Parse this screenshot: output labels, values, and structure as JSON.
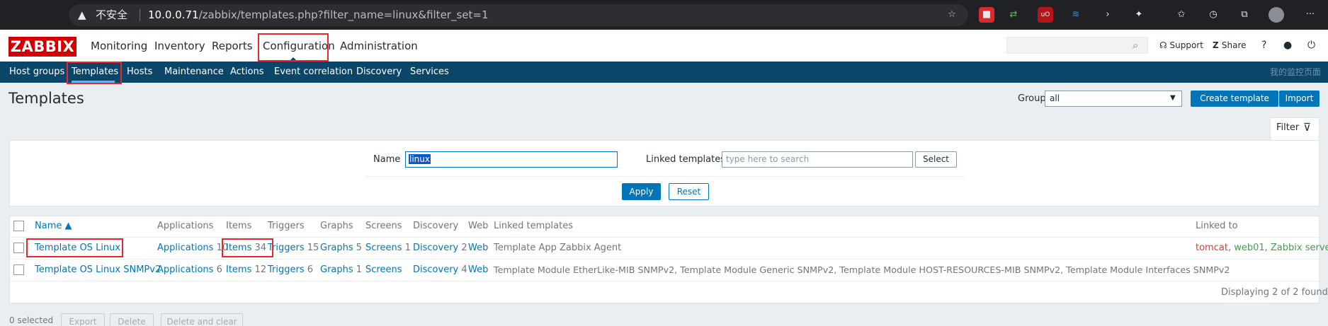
{
  "browser": {
    "url_warning": "不安全",
    "url_host": "10.0.0.71",
    "url_path": "/zabbix/templates.php?filter_name=linux&filter_set=1"
  },
  "header": {
    "logo": "ZABBIX",
    "menu": [
      "Monitoring",
      "Inventory",
      "Reports",
      "Configuration",
      "Administration"
    ],
    "support": "Support",
    "share": "Share",
    "help": "?"
  },
  "submenu": {
    "items": [
      "Host groups",
      "Templates",
      "Hosts",
      "Maintenance",
      "Actions",
      "Event correlation",
      "Discovery",
      "Services"
    ],
    "right_text": "我的监控页面"
  },
  "page": {
    "title": "Templates",
    "group_label": "Group",
    "group_value": "all",
    "create_button": "Create template",
    "import_button": "Import"
  },
  "filter": {
    "tab_label": "Filter",
    "name_label": "Name",
    "name_value": "linux",
    "linked_label": "Linked templates",
    "linked_placeholder": "type here to search",
    "select_button": "Select",
    "apply_button": "Apply",
    "reset_button": "Reset"
  },
  "table": {
    "headers": [
      "Name ▲",
      "Applications",
      "Items",
      "Triggers",
      "Graphs",
      "Screens",
      "Discovery",
      "Web",
      "Linked templates",
      "Linked to"
    ],
    "rows": [
      {
        "name": "Template OS Linux",
        "applications": "Applications",
        "applications_count": "10",
        "items": "Items",
        "items_count": "34",
        "triggers": "Triggers",
        "triggers_count": "15",
        "graphs": "Graphs",
        "graphs_count": "5",
        "screens": "Screens",
        "screens_count": "1",
        "discovery": "Discovery",
        "discovery_count": "2",
        "web": "Web",
        "linked_templates": "Template App Zabbix Agent",
        "linked_to": [
          "tomcat",
          "web01",
          "Zabbix server"
        ]
      },
      {
        "name": "Template OS Linux SNMPv2",
        "applications": "Applications",
        "applications_count": "6",
        "items": "Items",
        "items_count": "12",
        "triggers": "Triggers",
        "triggers_count": "6",
        "graphs": "Graphs",
        "graphs_count": "1",
        "screens": "Screens",
        "screens_count": "",
        "discovery": "Discovery",
        "discovery_count": "4",
        "web": "Web",
        "linked_templates": "Template Module EtherLike-MIB SNMPv2, Template Module Generic SNMPv2, Template Module HOST-RESOURCES-MIB SNMPv2, Template Module Interfaces SNMPv2",
        "linked_to": []
      }
    ],
    "footer": "Displaying 2 of 2 found"
  },
  "actions": {
    "selected": "0 selected",
    "export": "Export",
    "delete": "Delete",
    "delete_clear": "Delete and clear"
  },
  "colors": {
    "brand_red": "#d40000",
    "nav_blue": "#0a466a",
    "link_blue": "#0275b8",
    "highlight_red": "#e8282c"
  }
}
